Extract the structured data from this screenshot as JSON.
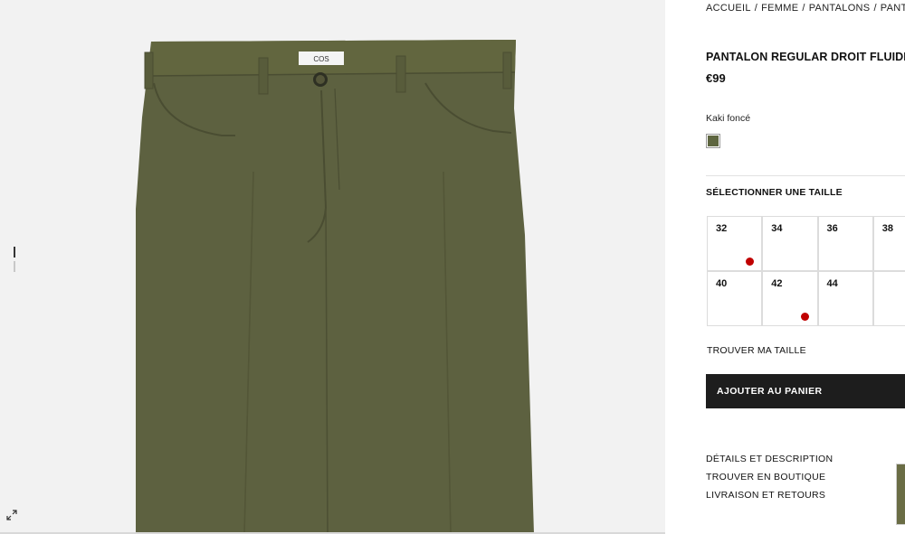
{
  "breadcrumb": {
    "items": [
      "ACCUEIL",
      "FEMME",
      "PANTALONS",
      "PANTALONS"
    ],
    "separator": "/"
  },
  "product": {
    "brand_label": "COS",
    "title": "PANTALON REGULAR DROIT FLUIDE",
    "price": "€99",
    "color_name": "Kaki foncé",
    "color_hex": "#5e6640"
  },
  "sizes": {
    "heading": "SÉLECTIONNER UNE TAILLE",
    "options": [
      {
        "label": "32",
        "low_stock": true
      },
      {
        "label": "34",
        "low_stock": false
      },
      {
        "label": "36",
        "low_stock": false
      },
      {
        "label": "38",
        "low_stock": false
      },
      {
        "label": "40",
        "low_stock": false
      },
      {
        "label": "42",
        "low_stock": true
      },
      {
        "label": "44",
        "low_stock": false
      }
    ],
    "low_stock_color": "#c00000",
    "find_size": "TROUVER MA TAILLE"
  },
  "cart": {
    "add_label": "AJOUTER AU PANIER"
  },
  "links": [
    "DÉTAILS ET DESCRIPTION",
    "TROUVER EN BOUTIQUE",
    "LIVRAISON ET RETOURS"
  ],
  "gallery": {
    "image_count": 2,
    "active_index": 0
  }
}
